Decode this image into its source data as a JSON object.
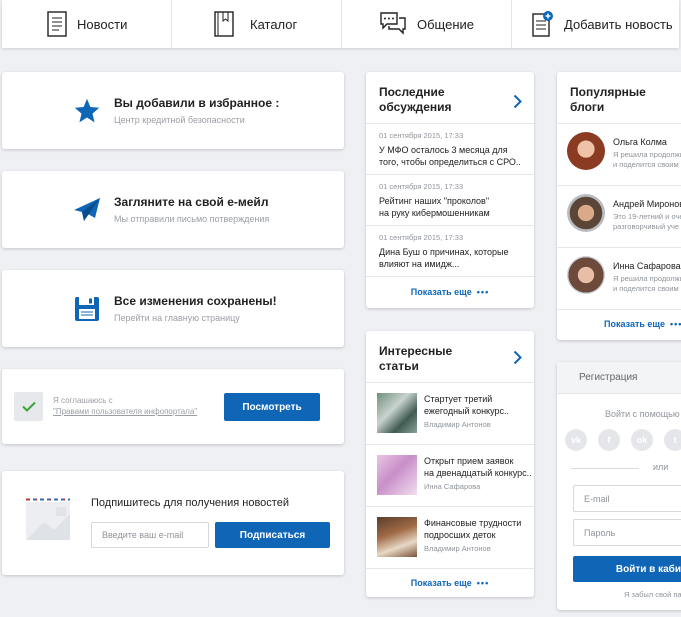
{
  "nav": {
    "items": [
      {
        "label": "Новости",
        "icon": "newspaper-icon"
      },
      {
        "label": "Каталог",
        "icon": "catalog-book-icon"
      },
      {
        "label": "Общение",
        "icon": "chat-bubbles-icon"
      },
      {
        "label": "Добавить новость",
        "icon": "add-news-icon"
      }
    ]
  },
  "notices": {
    "favorite": {
      "title": "Вы добавили в избранное :",
      "subtitle": "Центр кредитной безопасности",
      "icon": "star-icon"
    },
    "email": {
      "title": "Загляните на свой е-мейл",
      "subtitle": "Мы отправили письмо потверждения",
      "icon": "paper-plane-icon"
    },
    "saved": {
      "title": "Все изменения сохранены!",
      "subtitle": "Перейти на главную страницу",
      "icon": "floppy-disk-icon"
    }
  },
  "agreement": {
    "text_line1": "Я соглашаюсь с",
    "text_link": "\"Правами пользователя инфопортала\"",
    "button": "Посмотреть",
    "checked": true
  },
  "subscribe": {
    "title": "Подпишитесь для получения новостей",
    "placeholder": "Введите ваш e-mail",
    "button": "Подписаться"
  },
  "discussions": {
    "title_line1": "Последние",
    "title_line2": "обсуждения",
    "items": [
      {
        "date": "01 сентября 2015, 17:33",
        "line1": "У МФО осталось 3 месяца для",
        "line2": "того, чтобы определиться с СРО.."
      },
      {
        "date": "01 сентября 2015, 17:33",
        "line1": "Рейтинг наших \"проколов\"",
        "line2": "на руку кибермошенникам"
      },
      {
        "date": "01 сентября 2015, 17:33",
        "line1": "Дина Буш о причинах, которые",
        "line2": "влияют на имидж..."
      }
    ],
    "more": "Показать еще"
  },
  "articles": {
    "title_line1": "Интересные",
    "title_line2": "статьи",
    "items": [
      {
        "line1": "Стартует третий",
        "line2": "ежегодный конкурс..",
        "author": "Владимир Антонов"
      },
      {
        "line1": "Открыт прием заявок",
        "line2": "на двенадцатый конкурс..",
        "author": "Инна Сафарова"
      },
      {
        "line1": "Финансовые трудности",
        "line2": "подросших деток",
        "author": "Владимир Антонов"
      }
    ],
    "more": "Показать еще"
  },
  "blogs": {
    "title_line1": "Популярные",
    "title_line2": "блоги",
    "items": [
      {
        "name": "Ольга Колма",
        "line1": "Я решила продолжи",
        "line2": "и поделится своим"
      },
      {
        "name": "Андрей Миронов",
        "line1": "Это 19-летний и оче",
        "line2": "разговорчивый уче"
      },
      {
        "name": "Инна Сафарова",
        "line1": "Я решила продолжи",
        "line2": "и поделится своим"
      }
    ],
    "more": "Показать еще"
  },
  "register": {
    "tab": "Регистрация",
    "social_label": "Войти с помощью",
    "or": "или",
    "email_placeholder": "E-mail",
    "password_placeholder": "Пароль",
    "button": "Войти в каби",
    "forgot": "Я забыл свой па",
    "socials": [
      "vk-icon",
      "facebook-icon",
      "odnoklassniki-icon",
      "twitter-icon"
    ]
  },
  "colors": {
    "accent": "#0f66b7",
    "check": "#3aa63a",
    "bg": "#eef0f3"
  }
}
